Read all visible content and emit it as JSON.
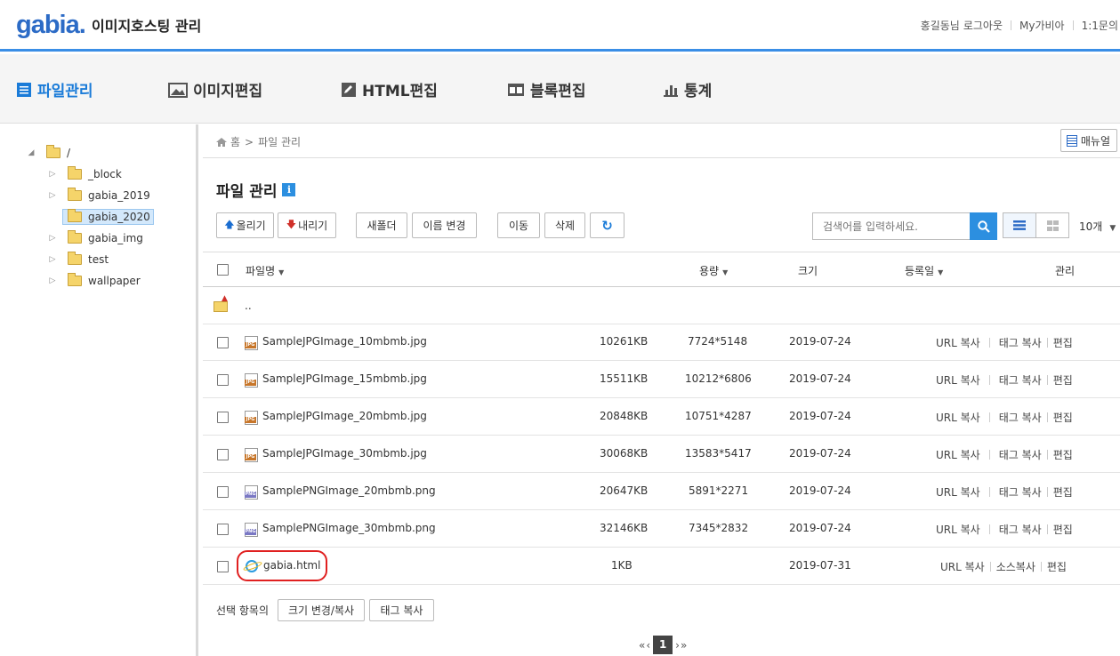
{
  "header": {
    "logo": "gabia.",
    "app_title": "이미지호스팅 관리",
    "user_greeting": "홍길동님",
    "logout": "로그아웃",
    "my_gabia": "My가비아",
    "inquiry": "1:1문의"
  },
  "menu": {
    "file_manage": "파일관리",
    "image_edit": "이미지편집",
    "html_edit": "HTML편집",
    "block_edit": "블록편집",
    "stats": "통계"
  },
  "tree": {
    "root": "/",
    "items": [
      {
        "label": "_block"
      },
      {
        "label": "gabia_2019"
      },
      {
        "label": "gabia_2020",
        "selected": true
      },
      {
        "label": "gabia_img"
      },
      {
        "label": "test"
      },
      {
        "label": "wallpaper"
      }
    ]
  },
  "breadcrumb": {
    "home": "홈",
    "separator": ">",
    "current": "파일 관리"
  },
  "manual_label": "매뉴얼",
  "page_title": "파일 관리",
  "toolbar": {
    "upload": "올리기",
    "download": "내리기",
    "new_folder": "새폴더",
    "rename": "이름 변경",
    "move": "이동",
    "delete": "삭제",
    "search_placeholder": "검색어를 입력하세요.",
    "page_size": "10개"
  },
  "table": {
    "headers": {
      "name": "파일명",
      "size": "용량",
      "dimensions": "크기",
      "date": "등록일",
      "manage": "관리"
    },
    "parent_dir": "..",
    "rows": [
      {
        "name": "SampleJPGImage_10mbmb.jpg",
        "type": "jpg",
        "size": "10261KB",
        "dims": "7724*5148",
        "date": "2019-07-24",
        "a1": "URL 복사",
        "a2": "태그 복사",
        "a3": "편집"
      },
      {
        "name": "SampleJPGImage_15mbmb.jpg",
        "type": "jpg",
        "size": "15511KB",
        "dims": "10212*6806",
        "date": "2019-07-24",
        "a1": "URL 복사",
        "a2": "태그 복사",
        "a3": "편집"
      },
      {
        "name": "SampleJPGImage_20mbmb.jpg",
        "type": "jpg",
        "size": "20848KB",
        "dims": "10751*4287",
        "date": "2019-07-24",
        "a1": "URL 복사",
        "a2": "태그 복사",
        "a3": "편집"
      },
      {
        "name": "SampleJPGImage_30mbmb.jpg",
        "type": "jpg",
        "size": "30068KB",
        "dims": "13583*5417",
        "date": "2019-07-24",
        "a1": "URL 복사",
        "a2": "태그 복사",
        "a3": "편집"
      },
      {
        "name": "SamplePNGImage_20mbmb.png",
        "type": "png",
        "size": "20647KB",
        "dims": "5891*2271",
        "date": "2019-07-24",
        "a1": "URL 복사",
        "a2": "태그 복사",
        "a3": "편집"
      },
      {
        "name": "SamplePNGImage_30mbmb.png",
        "type": "png",
        "size": "32146KB",
        "dims": "7345*2832",
        "date": "2019-07-24",
        "a1": "URL 복사",
        "a2": "태그 복사",
        "a3": "편집"
      },
      {
        "name": "gabia.html",
        "type": "html",
        "size": "1KB",
        "dims": "",
        "date": "2019-07-31",
        "a1": "URL 복사",
        "a2": "소스복사",
        "a3": "편집"
      }
    ]
  },
  "footer": {
    "selected_label": "선택 항목의",
    "resize_copy": "크기 변경/복사",
    "tag_copy": "태그 복사"
  },
  "pager": {
    "first": "«",
    "prev": "‹",
    "current": "1",
    "next": "›",
    "last": "»"
  }
}
